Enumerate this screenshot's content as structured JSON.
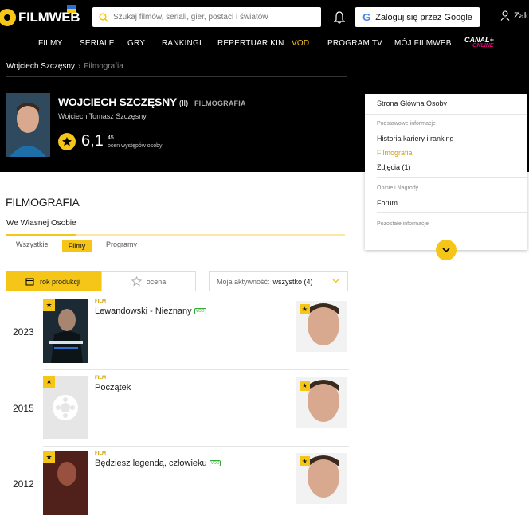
{
  "header": {
    "logo": "FILMWEB",
    "search_placeholder": "Szukaj filmów, seriali, gier, postaci i światów",
    "google_login": "Zaloguj się przez Google",
    "user_label": "Zalo"
  },
  "nav": {
    "items": [
      "FILMY",
      "SERIALE",
      "GRY",
      "RANKINGI",
      "REPERTUAR KIN",
      "VOD",
      "PROGRAM TV",
      "MÓJ FILMWEB"
    ],
    "canal": "CANAL+",
    "canal_sub": "ONLINE"
  },
  "breadcrumb": {
    "person": "Wojciech Szczęsny",
    "current": "Filmografia"
  },
  "person": {
    "name": "WOJCIECH SZCZĘSNY",
    "suffix": "(II)",
    "section": "FILMOGRAFIA",
    "full_name": "Wojciech Tomasz Szczęsny",
    "rating": "6,1",
    "rating_count": "45",
    "rating_label": "ocen występów osoby"
  },
  "sidebar": {
    "home": "Strona Główna Osoby",
    "basic_header": "Podstawowe informacje",
    "career": "Historia kariery i ranking",
    "filmography": "Filmografia",
    "photos": "Zdjęcia (1)",
    "opinions_header": "Opinie i Nagrody",
    "forum": "Forum",
    "other_header": "Pozostałe informacje"
  },
  "filmography": {
    "title": "FILMOGRAFIA",
    "tab": "We Własnej Osobie",
    "filters": {
      "all": "Wszystkie",
      "films": "Filmy",
      "programs": "Programy"
    },
    "sort_year": "rok produkcji",
    "sort_rating": "ocena",
    "activity_label": "Moja aktywność:",
    "activity_value": "wszystko (4)"
  },
  "rows": [
    {
      "year": "2023",
      "kind": "FILM",
      "title": "Lewandowski - Nieznany",
      "vod": "VOD"
    },
    {
      "year": "2015",
      "kind": "FILM",
      "title": "Początek",
      "vod": ""
    },
    {
      "year": "2012",
      "kind": "FILM",
      "title": "Będziesz legendą, człowieku",
      "vod": "VOD"
    }
  ],
  "colors": {
    "accent": "#f5c518",
    "header_bg": "#000000"
  }
}
